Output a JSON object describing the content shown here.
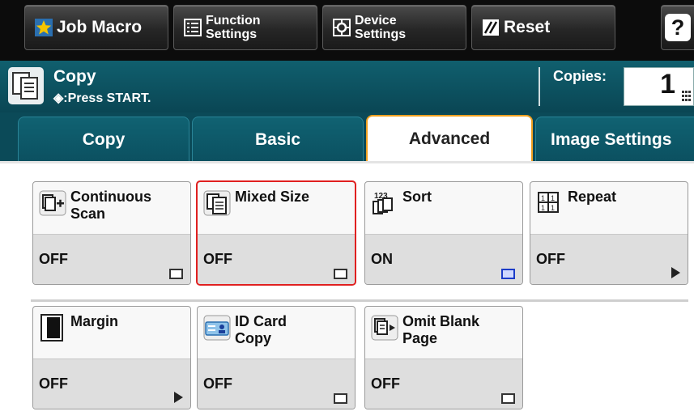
{
  "toolbar": {
    "job_macro": "Job Macro",
    "function_settings": "Function\nSettings",
    "device_settings": "Device\nSettings",
    "reset": "Reset",
    "help": "?"
  },
  "status": {
    "title": "Copy",
    "subtitle": "◈:Press START.",
    "copies_label": "Copies:",
    "copies_value": "1"
  },
  "tabs": [
    {
      "label": "Copy",
      "active": false
    },
    {
      "label": "Basic",
      "active": false
    },
    {
      "label": "Advanced",
      "active": true
    },
    {
      "label": "Image Settings",
      "active": false
    }
  ],
  "functions": [
    {
      "label": "Continuous\nScan",
      "state": "OFF",
      "icon": "continuous-scan-icon",
      "indicator": "box"
    },
    {
      "label": "Mixed Size",
      "state": "OFF",
      "icon": "mixed-size-icon",
      "indicator": "box",
      "selected": true
    },
    {
      "label": "Sort",
      "state": "ON",
      "icon": "sort-icon",
      "indicator": "box-blue"
    },
    {
      "label": "Repeat",
      "state": "OFF",
      "icon": "repeat-icon",
      "indicator": "arrow"
    },
    {
      "label": "Margin",
      "state": "OFF",
      "icon": "margin-icon",
      "indicator": "arrow"
    },
    {
      "label": "ID Card\nCopy",
      "state": "OFF",
      "icon": "id-card-copy-icon",
      "indicator": "box"
    },
    {
      "label": "Omit Blank\nPage",
      "state": "OFF",
      "icon": "omit-blank-page-icon",
      "indicator": "box"
    }
  ],
  "colors": {
    "status_teal": "#0a4654",
    "tab_active_border": "#f0a020",
    "selection_red": "#e02020",
    "star_yellow": "#f5c400"
  }
}
